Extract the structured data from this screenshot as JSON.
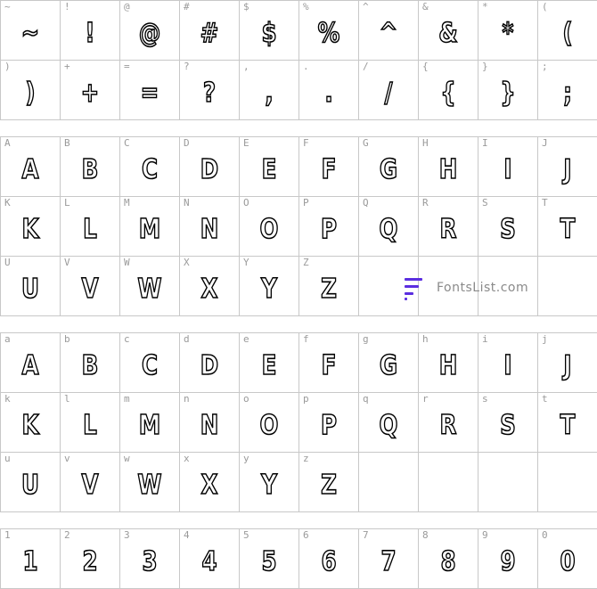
{
  "symbols": [
    {
      "label": "~",
      "glyph": "~"
    },
    {
      "label": "!",
      "glyph": "!"
    },
    {
      "label": "@",
      "glyph": "@"
    },
    {
      "label": "#",
      "glyph": "#"
    },
    {
      "label": "$",
      "glyph": "$"
    },
    {
      "label": "%",
      "glyph": "%"
    },
    {
      "label": "^",
      "glyph": "^"
    },
    {
      "label": "&",
      "glyph": "&"
    },
    {
      "label": "*",
      "glyph": "*"
    },
    {
      "label": "(",
      "glyph": "("
    },
    {
      "label": ")",
      "glyph": ")"
    },
    {
      "label": "+",
      "glyph": "+"
    },
    {
      "label": "=",
      "glyph": "="
    },
    {
      "label": "?",
      "glyph": "?"
    },
    {
      "label": ",",
      "glyph": ","
    },
    {
      "label": ".",
      "glyph": "."
    },
    {
      "label": "/",
      "glyph": "/"
    },
    {
      "label": "{",
      "glyph": "{"
    },
    {
      "label": "}",
      "glyph": "}"
    },
    {
      "label": ";",
      "glyph": ";"
    }
  ],
  "uppercase": [
    {
      "label": "A",
      "glyph": "A"
    },
    {
      "label": "B",
      "glyph": "B"
    },
    {
      "label": "C",
      "glyph": "C"
    },
    {
      "label": "D",
      "glyph": "D"
    },
    {
      "label": "E",
      "glyph": "E"
    },
    {
      "label": "F",
      "glyph": "F"
    },
    {
      "label": "G",
      "glyph": "G"
    },
    {
      "label": "H",
      "glyph": "H"
    },
    {
      "label": "I",
      "glyph": "I"
    },
    {
      "label": "J",
      "glyph": "J"
    },
    {
      "label": "K",
      "glyph": "K"
    },
    {
      "label": "L",
      "glyph": "L"
    },
    {
      "label": "M",
      "glyph": "M"
    },
    {
      "label": "N",
      "glyph": "N"
    },
    {
      "label": "O",
      "glyph": "O"
    },
    {
      "label": "P",
      "glyph": "P"
    },
    {
      "label": "Q",
      "glyph": "Q"
    },
    {
      "label": "R",
      "glyph": "R"
    },
    {
      "label": "S",
      "glyph": "S"
    },
    {
      "label": "T",
      "glyph": "T"
    },
    {
      "label": "U",
      "glyph": "U"
    },
    {
      "label": "V",
      "glyph": "V"
    },
    {
      "label": "W",
      "glyph": "W"
    },
    {
      "label": "X",
      "glyph": "X"
    },
    {
      "label": "Y",
      "glyph": "Y"
    },
    {
      "label": "Z",
      "glyph": "Z"
    }
  ],
  "lowercase": [
    {
      "label": "a",
      "glyph": "A"
    },
    {
      "label": "b",
      "glyph": "B"
    },
    {
      "label": "c",
      "glyph": "C"
    },
    {
      "label": "d",
      "glyph": "D"
    },
    {
      "label": "e",
      "glyph": "E"
    },
    {
      "label": "f",
      "glyph": "F"
    },
    {
      "label": "g",
      "glyph": "G"
    },
    {
      "label": "h",
      "glyph": "H"
    },
    {
      "label": "i",
      "glyph": "I"
    },
    {
      "label": "j",
      "glyph": "J"
    },
    {
      "label": "k",
      "glyph": "K"
    },
    {
      "label": "l",
      "glyph": "L"
    },
    {
      "label": "m",
      "glyph": "M"
    },
    {
      "label": "n",
      "glyph": "N"
    },
    {
      "label": "o",
      "glyph": "O"
    },
    {
      "label": "p",
      "glyph": "P"
    },
    {
      "label": "q",
      "glyph": "Q"
    },
    {
      "label": "r",
      "glyph": "R"
    },
    {
      "label": "s",
      "glyph": "S"
    },
    {
      "label": "t",
      "glyph": "T"
    },
    {
      "label": "u",
      "glyph": "U"
    },
    {
      "label": "v",
      "glyph": "V"
    },
    {
      "label": "w",
      "glyph": "W"
    },
    {
      "label": "x",
      "glyph": "X"
    },
    {
      "label": "y",
      "glyph": "Y"
    },
    {
      "label": "z",
      "glyph": "Z"
    }
  ],
  "digits": [
    {
      "label": "1",
      "glyph": "1"
    },
    {
      "label": "2",
      "glyph": "2"
    },
    {
      "label": "3",
      "glyph": "3"
    },
    {
      "label": "4",
      "glyph": "4"
    },
    {
      "label": "5",
      "glyph": "5"
    },
    {
      "label": "6",
      "glyph": "6"
    },
    {
      "label": "7",
      "glyph": "7"
    },
    {
      "label": "8",
      "glyph": "8"
    },
    {
      "label": "9",
      "glyph": "9"
    },
    {
      "label": "0",
      "glyph": "0"
    }
  ],
  "watermark": {
    "text": "FontsList.com",
    "logo_color": "#5b2ee0"
  }
}
